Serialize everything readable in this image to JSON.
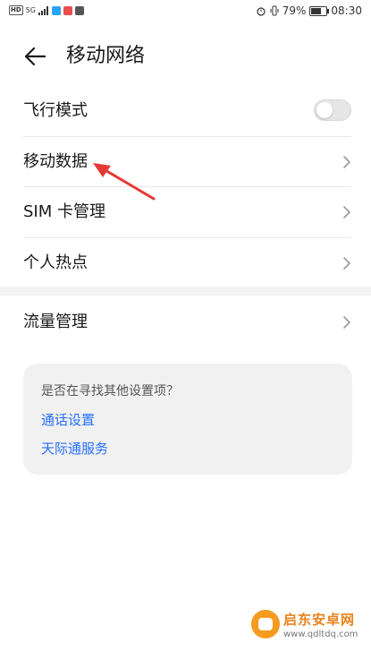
{
  "status_bar": {
    "left_badge": "HD",
    "signal_text": "5G",
    "battery_percent": "79%",
    "time": "08:30",
    "battery_level": 0.79,
    "icons": [
      "wifi-icon",
      "message-icon",
      "wechat-icon",
      "alarm-icon",
      "vibrate-icon"
    ]
  },
  "header": {
    "title": "移动网络"
  },
  "items": [
    {
      "label": "飞行模式",
      "type": "toggle",
      "on": false
    },
    {
      "label": "移动数据",
      "type": "link"
    },
    {
      "label": "SIM 卡管理",
      "type": "link"
    },
    {
      "label": "个人热点",
      "type": "link"
    }
  ],
  "traffic": {
    "label": "流量管理"
  },
  "suggestions": {
    "question": "是否在寻找其他设置项？",
    "links": [
      "通话设置",
      "天际通服务"
    ]
  },
  "watermark": {
    "name": "启东安卓网",
    "url": "www.qdltdq.com"
  },
  "colors": {
    "link": "#256fff",
    "annotation": "#e53935"
  }
}
